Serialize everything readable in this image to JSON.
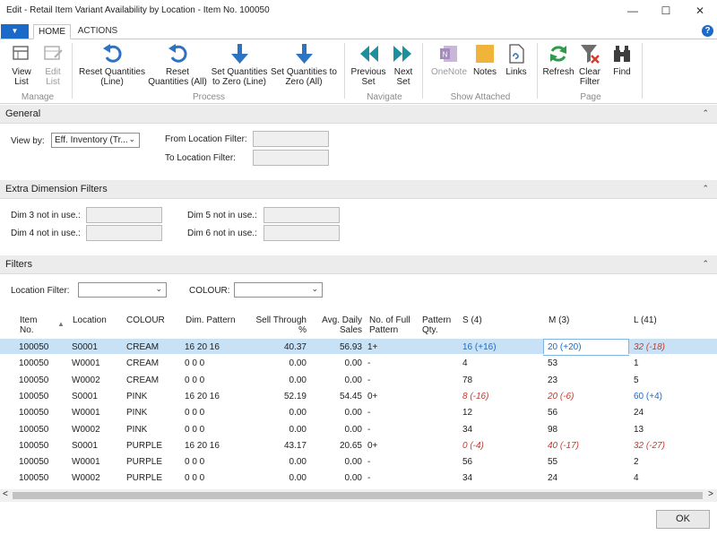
{
  "window": {
    "title": "Edit - Retail Item Variant Availability by Location - Item No. 100050",
    "minimize": "—",
    "maximize": "☐",
    "close": "✕"
  },
  "tabs": [
    "HOME",
    "ACTIONS"
  ],
  "help": "?",
  "ribbon": {
    "groups": [
      {
        "name": "Manage",
        "buttons": [
          {
            "label": "View List",
            "icon": "view-list-icon"
          },
          {
            "label": "Edit List",
            "icon": "edit-list-icon"
          }
        ]
      },
      {
        "name": "Process",
        "buttons": [
          {
            "label": "Reset Quantities (Line)",
            "icon": "reset-icon"
          },
          {
            "label": "Reset Quantities (All)",
            "icon": "reset-icon"
          },
          {
            "label": "Set Quantities to Zero (Line)",
            "icon": "arrow-down-icon"
          },
          {
            "label": "Set Quantities to Zero (All)",
            "icon": "arrow-down-icon"
          }
        ]
      },
      {
        "name": "Navigate",
        "buttons": [
          {
            "label": "Previous Set",
            "icon": "previous-icon"
          },
          {
            "label": "Next Set",
            "icon": "next-icon"
          }
        ]
      },
      {
        "name": "Show Attached",
        "buttons": [
          {
            "label": "OneNote",
            "icon": "onenote-icon"
          },
          {
            "label": "Notes",
            "icon": "notes-icon"
          },
          {
            "label": "Links",
            "icon": "links-icon"
          }
        ]
      },
      {
        "name": "Page",
        "buttons": [
          {
            "label": "Refresh",
            "icon": "refresh-icon"
          },
          {
            "label": "Clear Filter",
            "icon": "clear-filter-icon"
          },
          {
            "label": "Find",
            "icon": "find-icon"
          }
        ]
      }
    ]
  },
  "general": {
    "title": "General",
    "view_by_label": "View by:",
    "view_by_value": "Eff. Inventory (Tr...",
    "from_location_label": "From Location Filter:",
    "to_location_label": "To Location Filter:"
  },
  "extra_dims": {
    "title": "Extra Dimension Filters",
    "dim3": "Dim 3 not in use.:",
    "dim4": "Dim 4 not in use.:",
    "dim5": "Dim 5 not in use.:",
    "dim6": "Dim 6 not in use.:"
  },
  "filters": {
    "title": "Filters",
    "location_label": "Location Filter:",
    "colour_label": "COLOUR:"
  },
  "grid": {
    "headers": {
      "item_no": "Item No.",
      "location": "Location",
      "colour": "COLOUR",
      "dim_pattern": "Dim. Pattern",
      "sell_through": "Sell Through %",
      "avg_daily": "Avg. Daily Sales",
      "full_pattern": "No. of Full Pattern",
      "pattern_qty": "Pattern Qty.",
      "s": "S (4)",
      "m": "M (3)",
      "l": "L (41)"
    },
    "rows": [
      {
        "item": "100050",
        "loc": "S0001",
        "colour": "CREAM",
        "dim": "16  20  16",
        "sell": "40.37",
        "avg": "56.93",
        "full": "1+",
        "s": "16 (+16)",
        "s_style": "blue",
        "m": "20 (+20)",
        "m_style": "blue",
        "l": "32 (-18)",
        "l_style": "red"
      },
      {
        "item": "100050",
        "loc": "W0001",
        "colour": "CREAM",
        "dim": "0  0  0",
        "sell": "0.00",
        "avg": "0.00",
        "full": "-",
        "s": "4",
        "s_style": "",
        "m": "53",
        "m_style": "",
        "l": "1",
        "l_style": ""
      },
      {
        "item": "100050",
        "loc": "W0002",
        "colour": "CREAM",
        "dim": "0  0  0",
        "sell": "0.00",
        "avg": "0.00",
        "full": "-",
        "s": "78",
        "s_style": "",
        "m": "23",
        "m_style": "",
        "l": "5",
        "l_style": ""
      },
      {
        "item": "100050",
        "loc": "S0001",
        "colour": "PINK",
        "dim": "16  20  16",
        "sell": "52.19",
        "avg": "54.45",
        "full": "0+",
        "s": "8 (-16)",
        "s_style": "red",
        "m": "20 (-6)",
        "m_style": "red",
        "l": "60 (+4)",
        "l_style": "blue"
      },
      {
        "item": "100050",
        "loc": "W0001",
        "colour": "PINK",
        "dim": "0  0  0",
        "sell": "0.00",
        "avg": "0.00",
        "full": "-",
        "s": "12",
        "s_style": "",
        "m": "56",
        "m_style": "",
        "l": "24",
        "l_style": ""
      },
      {
        "item": "100050",
        "loc": "W0002",
        "colour": "PINK",
        "dim": "0  0  0",
        "sell": "0.00",
        "avg": "0.00",
        "full": "-",
        "s": "34",
        "s_style": "",
        "m": "98",
        "m_style": "",
        "l": "13",
        "l_style": ""
      },
      {
        "item": "100050",
        "loc": "S0001",
        "colour": "PURPLE",
        "dim": "16  20  16",
        "sell": "43.17",
        "avg": "20.65",
        "full": "0+",
        "s": "0 (-4)",
        "s_style": "red",
        "m": "40 (-17)",
        "m_style": "red",
        "l": "32 (-27)",
        "l_style": "red"
      },
      {
        "item": "100050",
        "loc": "W0001",
        "colour": "PURPLE",
        "dim": "0  0  0",
        "sell": "0.00",
        "avg": "0.00",
        "full": "-",
        "s": "56",
        "s_style": "",
        "m": "55",
        "m_style": "",
        "l": "2",
        "l_style": ""
      },
      {
        "item": "100050",
        "loc": "W0002",
        "colour": "PURPLE",
        "dim": "0  0  0",
        "sell": "0.00",
        "avg": "0.00",
        "full": "-",
        "s": "34",
        "s_style": "",
        "m": "24",
        "m_style": "",
        "l": "4",
        "l_style": ""
      }
    ]
  },
  "scroll": {
    "left": "<",
    "right": ">"
  },
  "ok_label": "OK"
}
